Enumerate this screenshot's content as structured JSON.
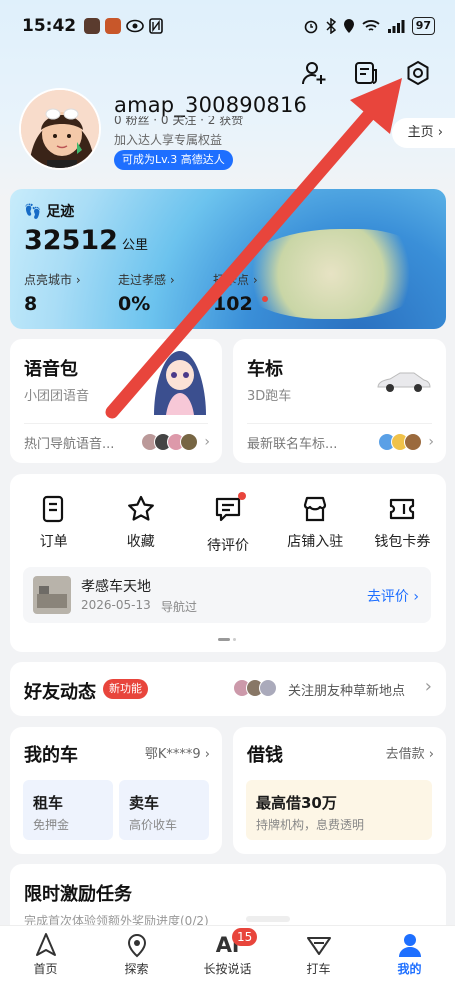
{
  "status_bar": {
    "time": "15:42",
    "battery": "97"
  },
  "profile": {
    "username": "amap_300890816",
    "stats_partial": "0 粉丝 · 0 关注 · 2 获赞",
    "subline": "加入达人享专属权益",
    "level_badge": "可成为Lv.3 高德达人",
    "homepage_label": "主页",
    "homepage_chevron": "›"
  },
  "footprint": {
    "title": "足迹",
    "km_value": "32512",
    "km_unit": "公里",
    "cols": [
      {
        "label": "点亮城市",
        "value": "8"
      },
      {
        "label": "走过孝感",
        "value": "0%"
      },
      {
        "label": "打卡点",
        "value": "102"
      }
    ]
  },
  "voice": {
    "title": "语音包",
    "sub": "小团团语音",
    "footer": "热门导航语音..."
  },
  "logo": {
    "title": "车标",
    "sub": "3D跑车",
    "footer": "最新联名车标..."
  },
  "tabs": [
    {
      "label": "订单",
      "icon": "order-icon"
    },
    {
      "label": "收藏",
      "icon": "star-icon"
    },
    {
      "label": "待评价",
      "icon": "comment-icon"
    },
    {
      "label": "店铺入驻",
      "icon": "shop-icon"
    },
    {
      "label": "钱包卡券",
      "icon": "wallet-icon"
    }
  ],
  "review": {
    "place": "孝感车天地",
    "date": "2026-05-13",
    "action": "导航过",
    "cta": "去评价 ›"
  },
  "friends": {
    "title": "好友动态",
    "badge": "新功能",
    "desc": "关注朋友种草新地点",
    "chevron": "›"
  },
  "car": {
    "title": "我的车",
    "plate": "鄂K****9 ›",
    "rent": {
      "title": "租车",
      "sub": "免押金"
    },
    "sell": {
      "title": "卖车",
      "sub": "高价收车"
    }
  },
  "loan": {
    "title": "借钱",
    "link": "去借款 ›",
    "headline": "最高借30万",
    "sub": "持牌机构，息费透明"
  },
  "tasks": {
    "title": "限时激励任务",
    "sub": "完成首次体验领额外奖励进度(0/2)"
  },
  "bottom_nav": [
    {
      "label": "首页",
      "icon": "home-nav-icon"
    },
    {
      "label": "探索",
      "icon": "explore-nav-icon"
    },
    {
      "label": "长按说话",
      "icon": "ai-nav-icon",
      "badge": "15",
      "glyph": "Ai"
    },
    {
      "label": "打车",
      "icon": "taxi-nav-icon"
    },
    {
      "label": "我的",
      "icon": "me-nav-icon"
    }
  ],
  "colors": {
    "accent": "#1e6fff",
    "red": "#e8453c",
    "arrow": "#e8453c"
  }
}
